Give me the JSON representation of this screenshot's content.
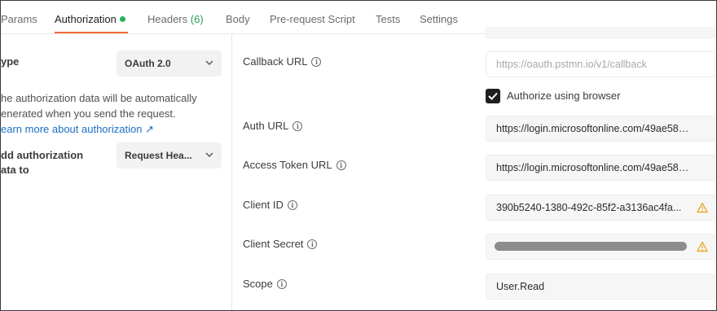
{
  "tabs": {
    "params": "Params",
    "authorization": "Authorization",
    "headers": "Headers",
    "headers_count": "(6)",
    "body": "Body",
    "prerequest": "Pre-request Script",
    "tests": "Tests",
    "settings": "Settings"
  },
  "left": {
    "type_label": "ype",
    "type_value": "OAuth 2.0",
    "help_line1": "he authorization data will be automatically",
    "help_line2": "enerated when you send the request.",
    "help_link": "earn more about authorization ↗",
    "add_to_label_line1": "dd authorization",
    "add_to_label_line2": "ata to",
    "add_to_value": "Request Hea..."
  },
  "fields": {
    "callback_url": {
      "label": "Callback URL",
      "placeholder": "https://oauth.pstmn.io/v1/callback"
    },
    "authorize_browser": {
      "label": "Authorize using browser",
      "checked": true
    },
    "auth_url": {
      "label": "Auth URL",
      "value": "https://login.microsoftonline.com/49ae583c..."
    },
    "access_token_url": {
      "label": "Access Token URL",
      "value": "https://login.microsoftonline.com/49ae583c..."
    },
    "client_id": {
      "label": "Client ID",
      "value": "390b5240-1380-492c-85f2-a3136ac4fa..."
    },
    "client_secret": {
      "label": "Client Secret"
    },
    "scope": {
      "label": "Scope",
      "value": "User.Read"
    }
  },
  "icons": {
    "info": "info-icon",
    "warning": "warning-icon",
    "chevron": "chevron-down-icon",
    "check": "check-icon"
  },
  "colors": {
    "accent_underline": "#f26b3a",
    "status_dot": "#26b35a",
    "link": "#1a6fc4",
    "warning": "#e8a21a"
  }
}
